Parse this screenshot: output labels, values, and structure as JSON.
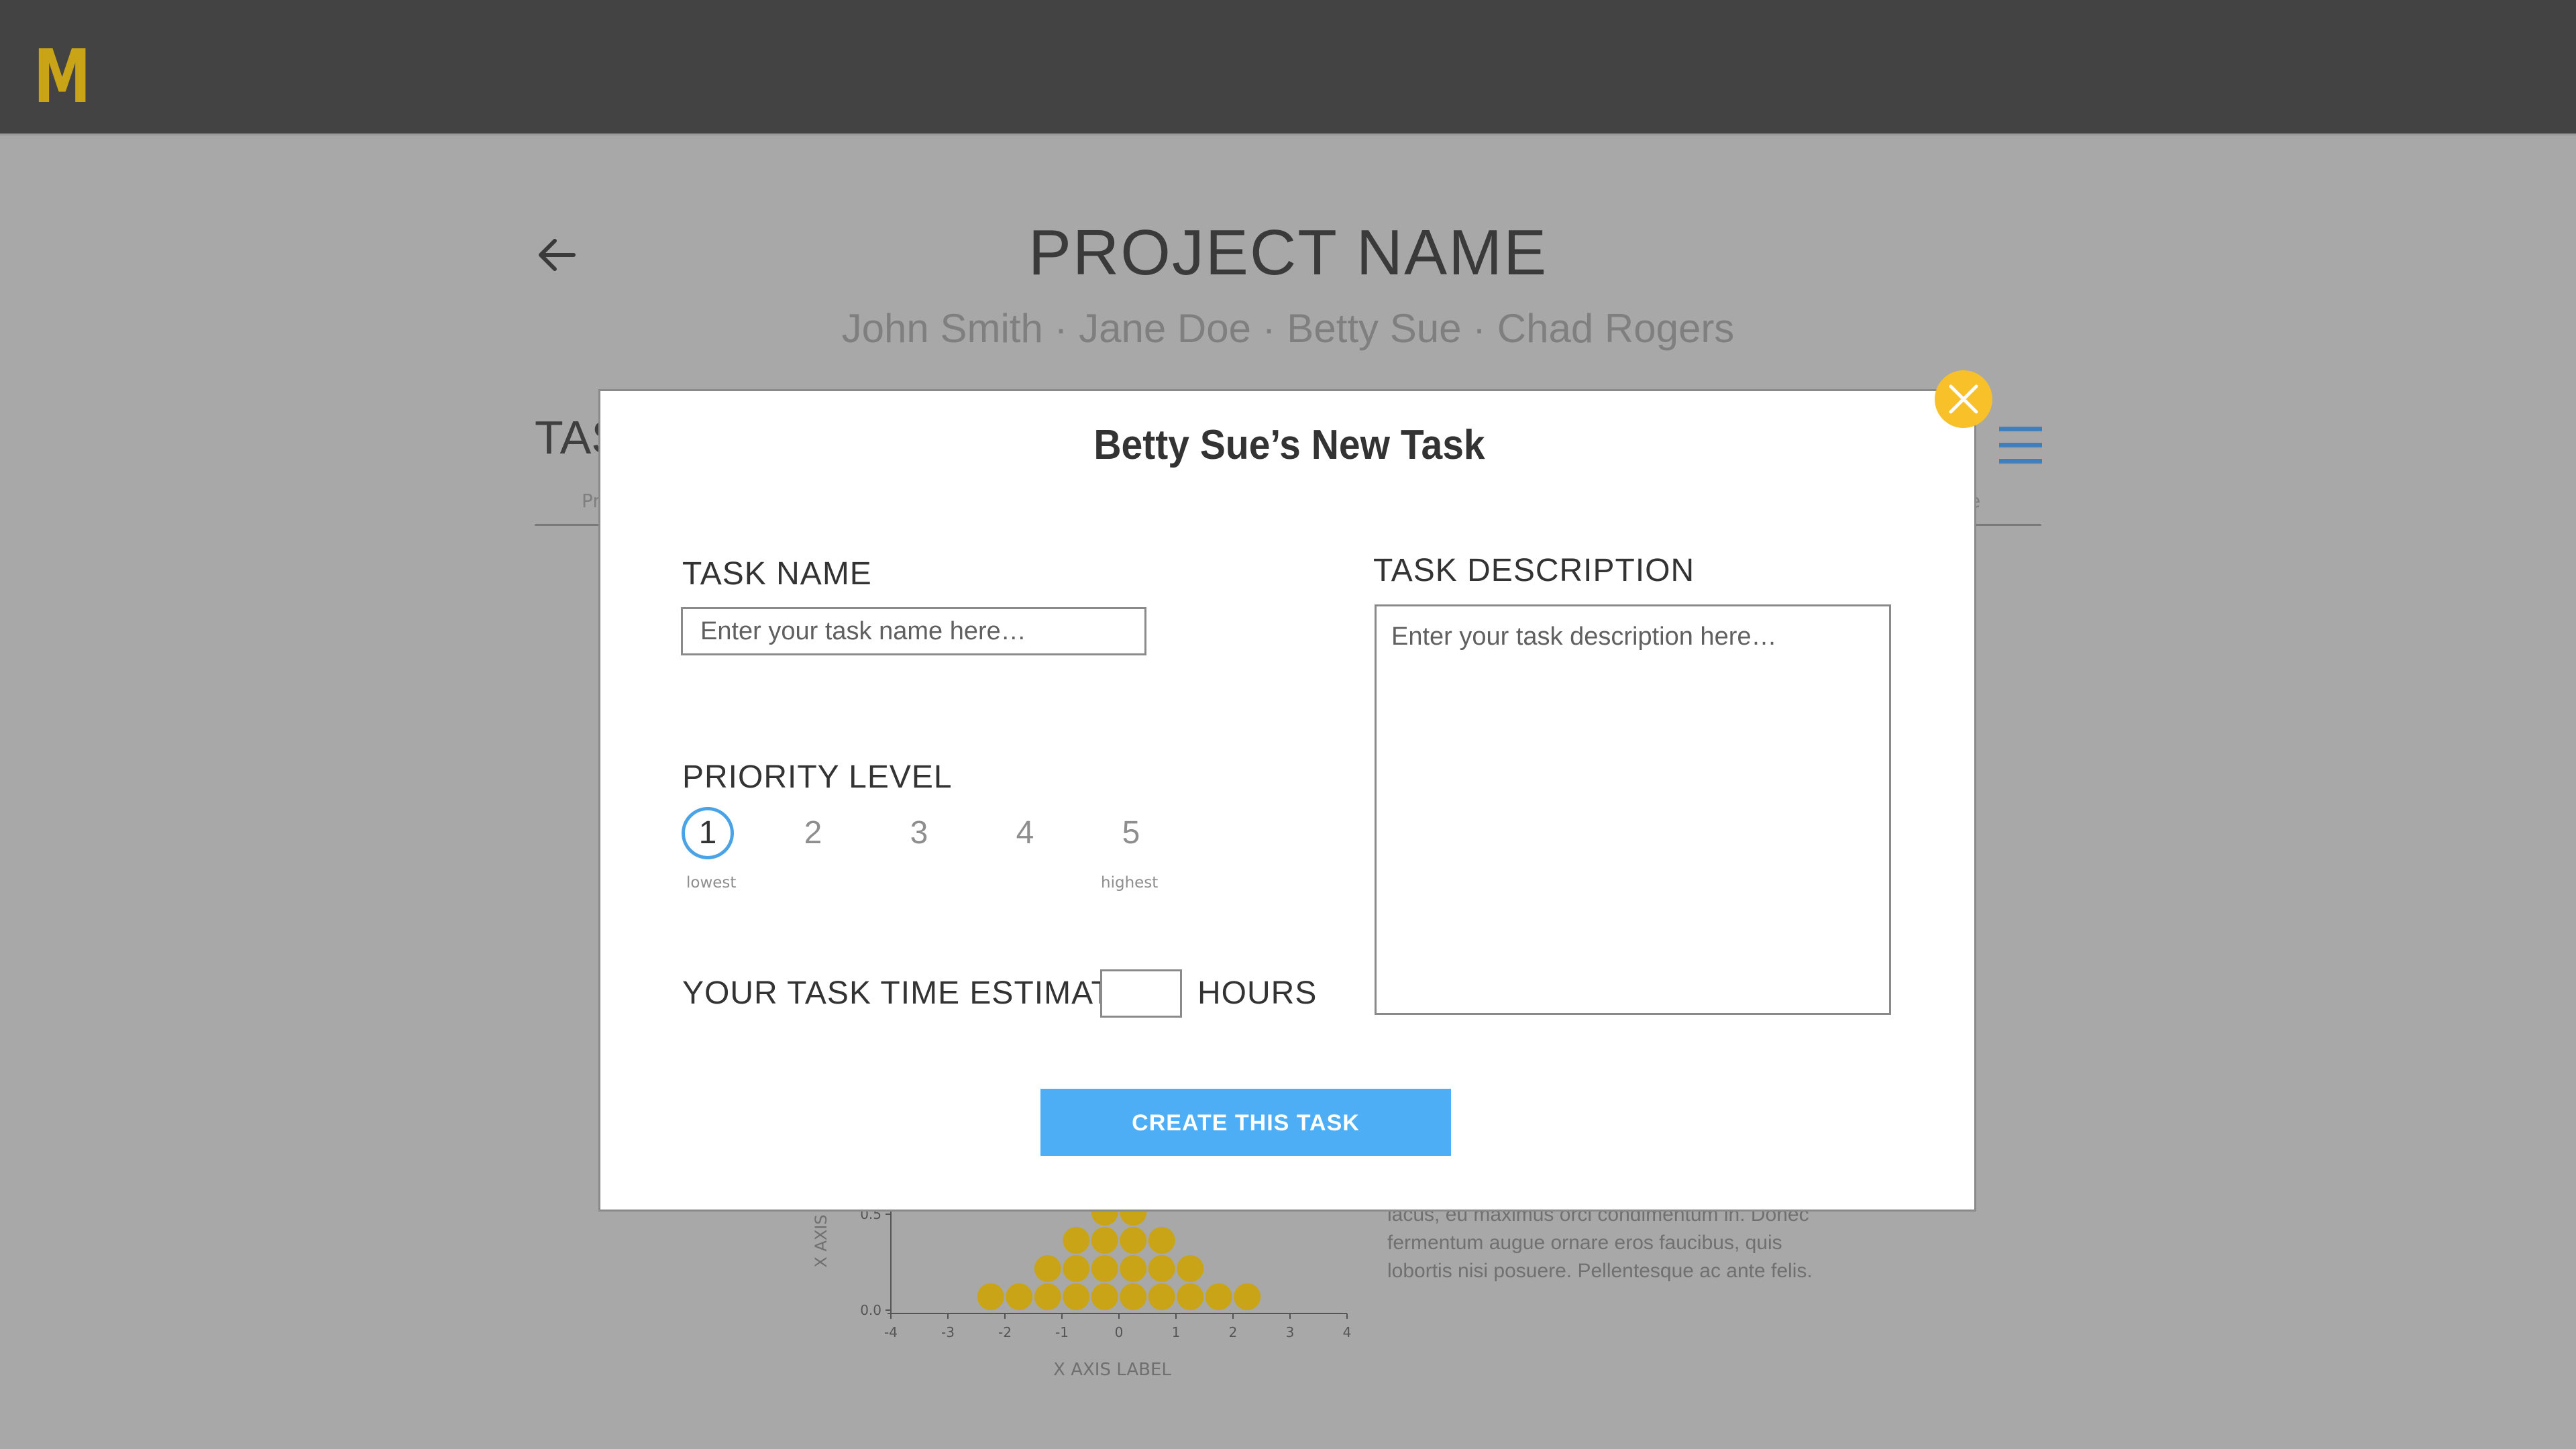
{
  "app": {
    "logo_text": "M"
  },
  "page": {
    "title": "PROJECT NAME",
    "members": "John Smith · Jane Doe · Betty Sue · Chad Rogers",
    "tasks_heading": "TAS",
    "tab_left_fragment": "Pr",
    "tab_right_fragment": "e"
  },
  "chart_data": {
    "type": "scatter",
    "ylabel": "X AXIS",
    "xlabel": "X AXIS LABEL",
    "x_ticks": [
      "-4",
      "-3",
      "-2",
      "-1",
      "0",
      "1",
      "2",
      "3",
      "4"
    ],
    "y_ticks": [
      "0.0",
      "0.5"
    ],
    "xlim": [
      -4,
      4
    ],
    "point_color": "#c9a417",
    "points_per_column": [
      {
        "x": -2.25,
        "count": 1
      },
      {
        "x": -1.75,
        "count": 1
      },
      {
        "x": -1.25,
        "count": 2
      },
      {
        "x": -0.75,
        "count": 3
      },
      {
        "x": -0.25,
        "count": 4
      },
      {
        "x": 0.25,
        "count": 4
      },
      {
        "x": 0.75,
        "count": 3
      },
      {
        "x": 1.25,
        "count": 2
      },
      {
        "x": 1.75,
        "count": 1
      },
      {
        "x": 2.25,
        "count": 1
      }
    ]
  },
  "background_text": {
    "lorem_lines": [
      "lacus, eu maximus orci condimentum in. Donec",
      "fermentum augue ornare eros faucibus, quis",
      "lobortis nisi posuere. Pellentesque ac ante felis."
    ]
  },
  "modal": {
    "title": "Betty Sue’s New Task",
    "close_icon": "close-icon",
    "task_name_label": "TASK NAME",
    "task_name_placeholder": "Enter your task name here…",
    "task_name_value": "",
    "priority_label": "PRIORITY LEVEL",
    "priority_levels": [
      "1",
      "2",
      "3",
      "4",
      "5"
    ],
    "priority_selected": "1",
    "priority_low_caption": "lowest",
    "priority_high_caption": "highest",
    "time_label": "YOUR TASK TIME ESTIMATE:",
    "time_value": "",
    "time_unit": "HOURS",
    "description_label": "TASK DESCRIPTION",
    "description_placeholder": "Enter your task description here…",
    "description_value": "",
    "create_button": "CREATE THIS TASK"
  },
  "colors": {
    "accent_blue": "#4daef5",
    "close_yellow": "#f8c12a",
    "logo_gold": "#c9a417",
    "topbar": "#434343"
  }
}
